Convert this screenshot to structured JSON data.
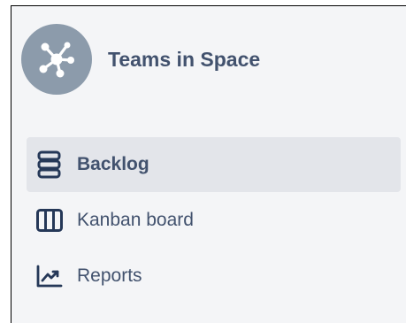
{
  "project": {
    "name": "Teams in Space",
    "avatar_icon": "network-hub-icon",
    "avatar_color": "#8c9bab"
  },
  "nav": {
    "items": [
      {
        "label": "Backlog",
        "icon": "backlog-icon",
        "selected": true
      },
      {
        "label": "Kanban board",
        "icon": "kanban-board-icon",
        "selected": false
      },
      {
        "label": "Reports",
        "icon": "reports-icon",
        "selected": false
      }
    ]
  },
  "colors": {
    "sidebar_background": "#f4f5f7",
    "selected_background": "#e3e5ea",
    "text": "#42526e",
    "icon": "#253858"
  }
}
